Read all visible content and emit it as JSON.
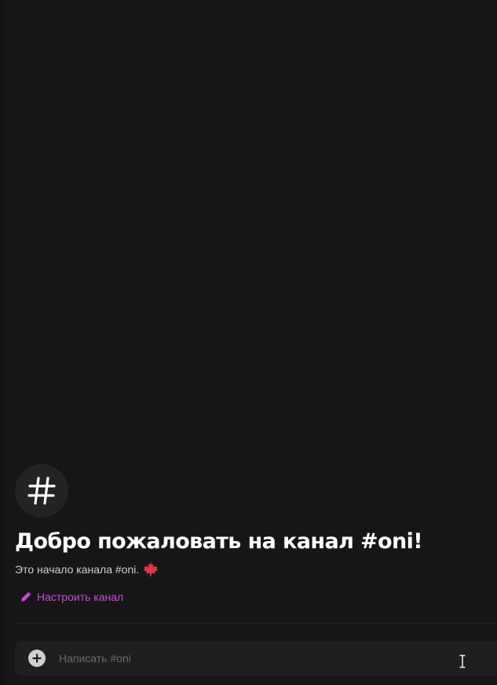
{
  "channel": {
    "icon": "hash-icon"
  },
  "welcome": {
    "title": "Добро пожаловать на канал #oni!",
    "description": "Это начало канала #oni.",
    "emoji": "maple-leaf-icon"
  },
  "actions": {
    "edit_channel_label": "Настроить канал",
    "edit_icon": "pencil-icon"
  },
  "composer": {
    "placeholder": "Написать #oni",
    "value": "",
    "attach_icon": "plus-circle-icon"
  },
  "colors": {
    "background": "#161616",
    "accent": "#c74bd6",
    "title": "#ffffff",
    "maple": "#e2354a"
  }
}
